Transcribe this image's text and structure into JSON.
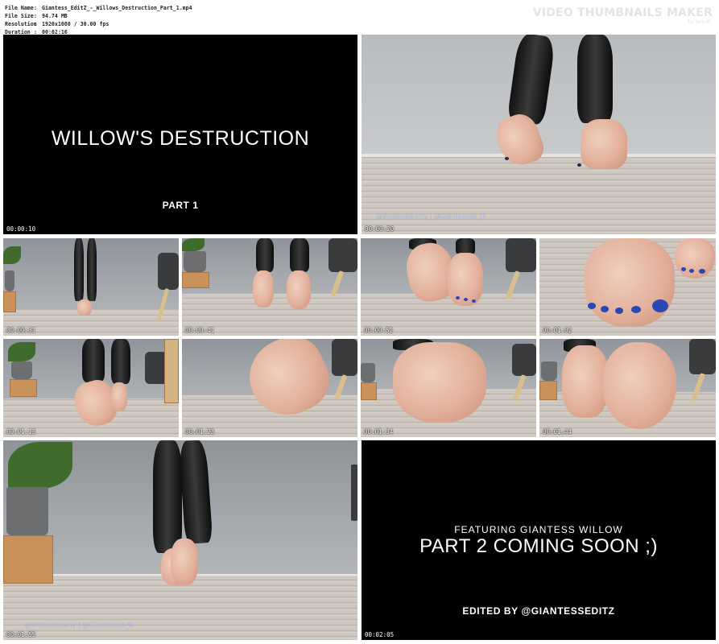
{
  "header": {
    "file_name_key": "File Name",
    "file_name_value": "Giantess_EditZ_-_Willows_Destruction_Part_1.mp4",
    "file_size_key": "File Size",
    "file_size_value": "94.74 MB",
    "resolution_key": "Resolution",
    "resolution_value": "1920x1080 / 30.00 fps",
    "duration_key": "Duration",
    "duration_value": "00:02:16",
    "separator": ":"
  },
  "brand": {
    "title": "VIDEO THUMBNAILS MAKER",
    "subtitle": "by Iwisoft"
  },
  "cards": {
    "intro_title": "WILLOW'S DESTRUCTION",
    "intro_part": "PART 1",
    "outro_featuring": "FEATURING GIANTESS WILLOW",
    "outro_main": "PART 2 COMING SOON ;)",
    "outro_editor": "EDITED BY @GIANTESSEDITZ"
  },
  "watermark": {
    "text": "@Willowdreamy | @Giantessed_tz"
  },
  "timestamps": {
    "t1": "00:00:10",
    "t2": "00:00:20",
    "t3": "00:00:31",
    "t4": "00:00:41",
    "t5": "00:00:52",
    "t6": "00:01:02",
    "t7": "00:01:13",
    "t8": "00:01:23",
    "t9": "00:01:34",
    "t10": "00:01:44",
    "t11": "00:01:55",
    "t12": "00:02:05"
  },
  "colors": {
    "nail_polish": "#2b47b4",
    "leggings": "#111111",
    "card_background": "#000000"
  }
}
